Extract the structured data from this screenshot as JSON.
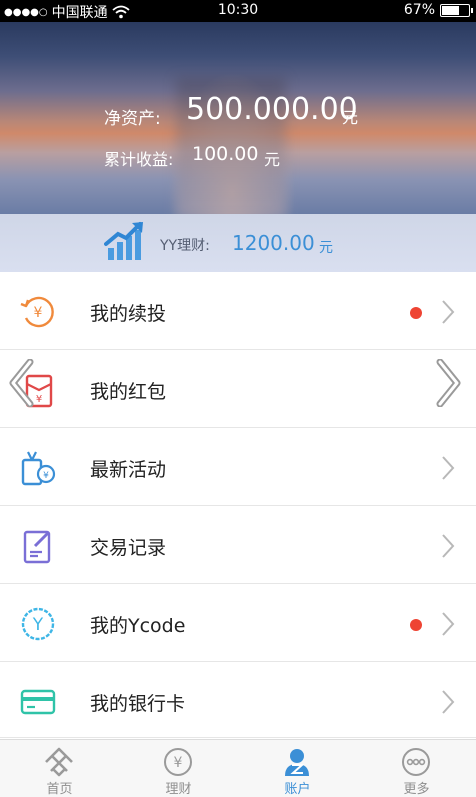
{
  "status_bar": {
    "signal": "●●●●○",
    "carrier": "中国联通",
    "time": "10:30",
    "battery_text": "67%",
    "battery_level": 0.67
  },
  "account": {
    "net_assets_label": "净资产:",
    "net_assets_value": "500.000.00",
    "net_assets_unit": "元",
    "earnings_label": "累计收益:",
    "earnings_value": "100.00",
    "earnings_unit": "元"
  },
  "yy": {
    "label": "YY理财:",
    "value": "1200.00",
    "unit": "元"
  },
  "menu": [
    {
      "label": "我的续投",
      "icon": "renew-yuan-icon",
      "dot": true
    },
    {
      "label": "我的红包",
      "icon": "red-envelope-icon",
      "dot": false
    },
    {
      "label": "最新活动",
      "icon": "gift-activity-icon",
      "dot": false
    },
    {
      "label": "交易记录",
      "icon": "transaction-record-icon",
      "dot": false
    },
    {
      "label": "我的Ycode",
      "icon": "ycode-icon",
      "dot": true
    },
    {
      "label": "我的银行卡",
      "icon": "bank-card-icon",
      "dot": false
    }
  ],
  "tabs": [
    {
      "label": "首页",
      "icon": "home-icon",
      "active": false
    },
    {
      "label": "理财",
      "icon": "finance-yuan-icon",
      "active": false
    },
    {
      "label": "账户",
      "icon": "account-user-icon",
      "active": true
    },
    {
      "label": "更多",
      "icon": "more-dots-icon",
      "active": false
    }
  ],
  "colors": {
    "accent_blue": "#3b8fd6",
    "notify_red": "#ee4433",
    "icon_orange": "#f08a3c",
    "icon_red": "#e04848",
    "icon_blue": "#3b8fd6",
    "icon_purple": "#7a6fd6",
    "icon_cyan": "#3fb6e6",
    "icon_teal": "#2fc3a8"
  }
}
